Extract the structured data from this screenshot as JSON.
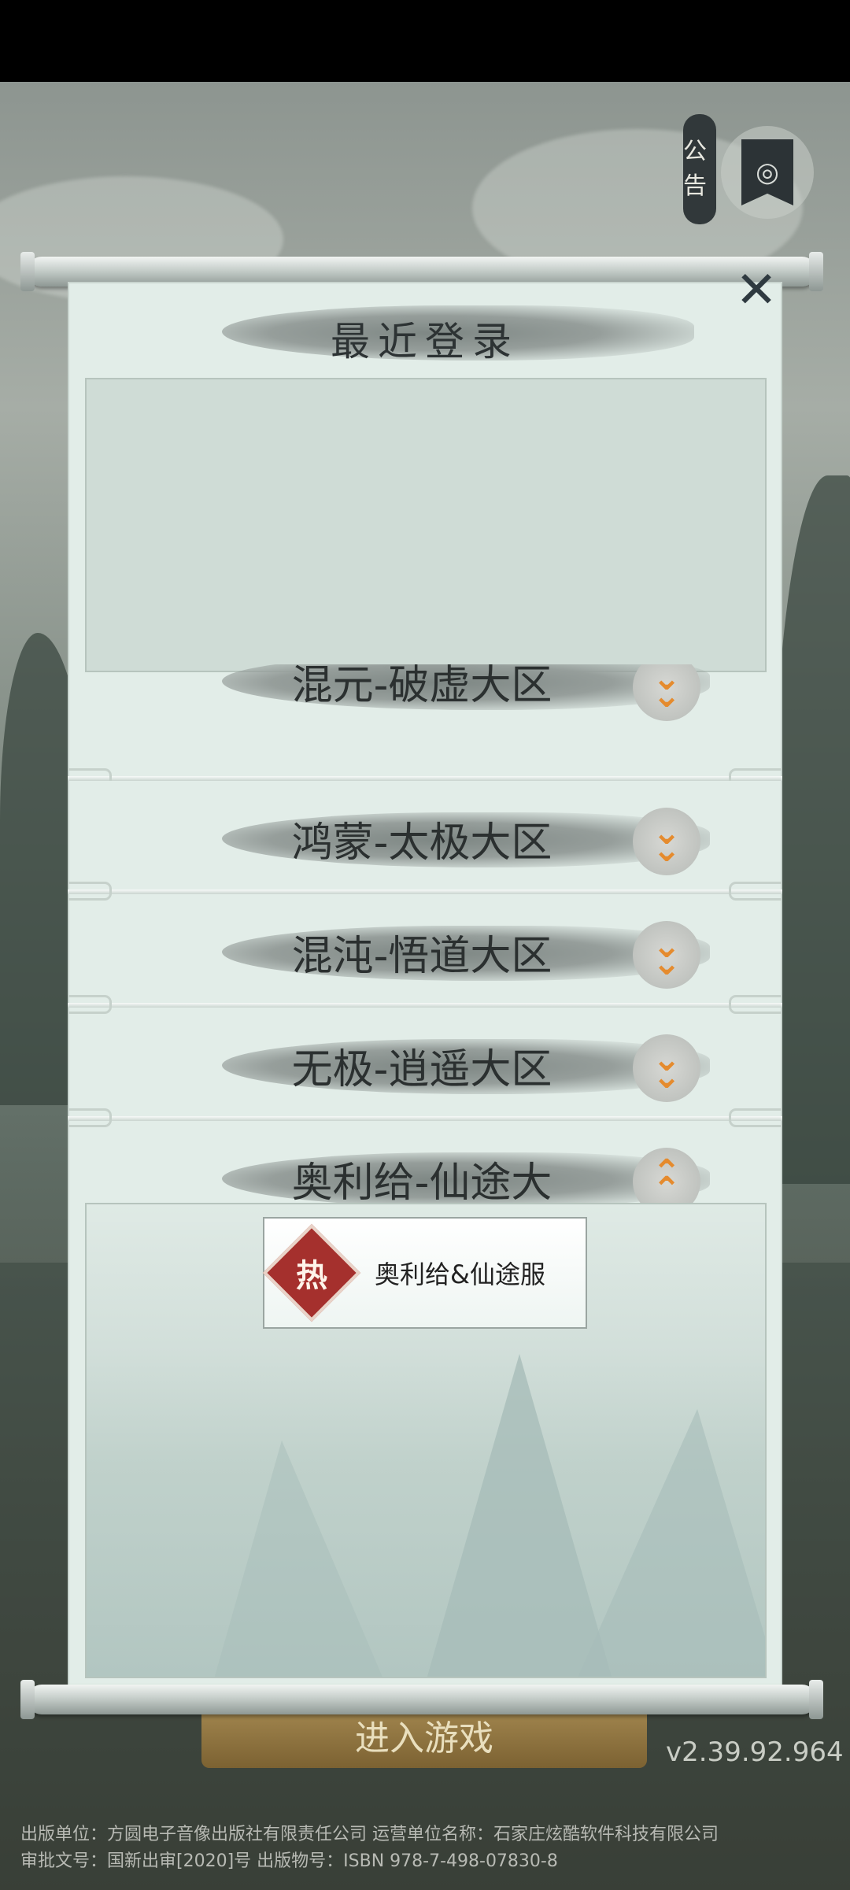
{
  "announcement": {
    "label": "公告"
  },
  "dialog": {
    "title": "最近登录",
    "close_icon": "close-icon",
    "regions": [
      {
        "label": "混元-破虚大区",
        "expanded": false
      },
      {
        "label": "鸿蒙-太极大区",
        "expanded": false
      },
      {
        "label": "混沌-悟道大区",
        "expanded": false
      },
      {
        "label": "无极-逍遥大区",
        "expanded": false
      },
      {
        "label": "奥利给-仙途大",
        "expanded": true
      }
    ],
    "servers": [
      {
        "badge": "热",
        "name": "奥利给&仙途服"
      }
    ]
  },
  "background": {
    "enter_game_label": "进入游戏",
    "version": "v2.39.92.964",
    "footer_line1": "出版单位：方圆电子音像出版社有限责任公司 运营单位名称：石家庄炫酷软件科技有限公司",
    "footer_line2": "审批文号：国新出审[2020]号 出版物号：ISBN 978-7-498-07830-8"
  },
  "colors": {
    "accent_chevron": "#e58b2e",
    "hot_badge": "#a5302d",
    "panel": "#e2ede8"
  }
}
